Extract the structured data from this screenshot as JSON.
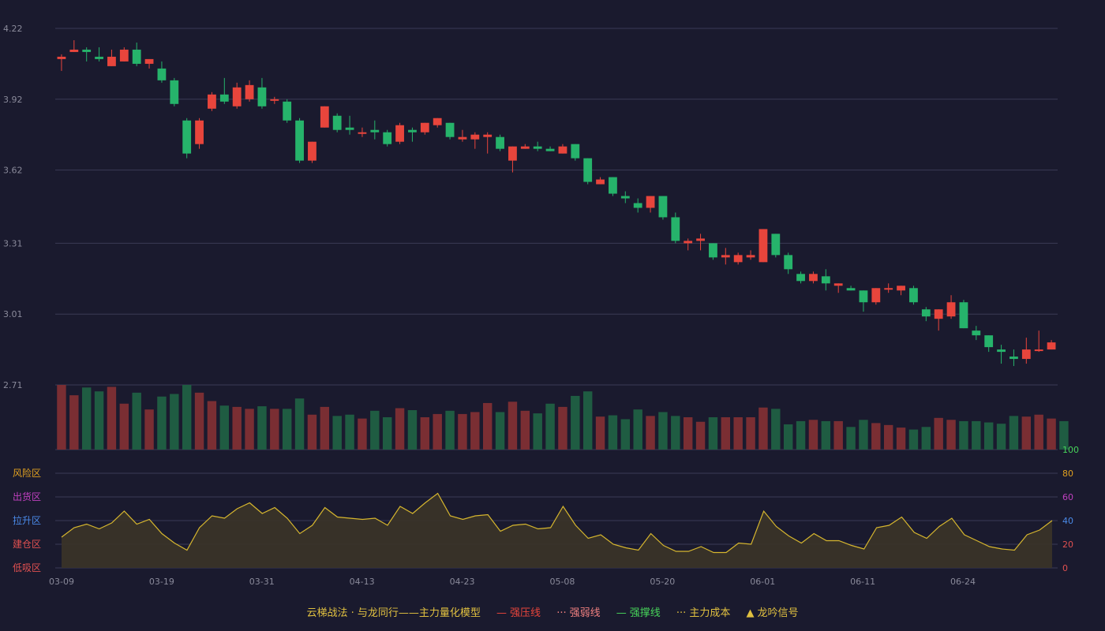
{
  "colors": {
    "background": "#1a1a2e",
    "up": "#e8453c",
    "down": "#26b36b",
    "vol_up": "#7a2e33",
    "vol_down": "#1f5c42",
    "grid": "#3a3a55",
    "axis_text": "#8a8a9a",
    "cost_line": "#d6b62e",
    "cost_fill": "#3b3428"
  },
  "chart_data": [
    {
      "type": "candlestick",
      "price_ticks": [
        "4.22",
        "3.92",
        "3.62",
        "3.31",
        "3.01",
        "2.71"
      ],
      "ylim": [
        2.71,
        4.22
      ],
      "grid": true,
      "candles": [
        [
          4.09,
          4.1,
          4.04,
          4.11
        ],
        [
          4.12,
          4.13,
          4.12,
          4.17
        ],
        [
          4.13,
          4.12,
          4.08,
          4.14
        ],
        [
          4.1,
          4.09,
          4.08,
          4.14
        ],
        [
          4.06,
          4.1,
          4.06,
          4.13
        ],
        [
          4.08,
          4.13,
          4.08,
          4.14
        ],
        [
          4.13,
          4.07,
          4.06,
          4.16
        ],
        [
          4.07,
          4.09,
          4.05,
          4.09
        ],
        [
          4.05,
          4.0,
          3.99,
          4.08
        ],
        [
          4.0,
          3.9,
          3.89,
          4.01
        ],
        [
          3.83,
          3.69,
          3.67,
          3.84
        ],
        [
          3.73,
          3.83,
          3.71,
          3.84
        ],
        [
          3.88,
          3.94,
          3.87,
          3.95
        ],
        [
          3.94,
          3.91,
          3.9,
          4.01
        ],
        [
          3.89,
          3.97,
          3.88,
          3.99
        ],
        [
          3.92,
          3.98,
          3.91,
          4.0
        ],
        [
          3.97,
          3.89,
          3.88,
          4.01
        ],
        [
          3.92,
          3.92,
          3.9,
          3.93
        ],
        [
          3.91,
          3.83,
          3.82,
          3.92
        ],
        [
          3.83,
          3.66,
          3.65,
          3.84
        ],
        [
          3.66,
          3.74,
          3.65,
          3.74
        ],
        [
          3.8,
          3.89,
          3.8,
          3.89
        ],
        [
          3.85,
          3.79,
          3.78,
          3.86
        ],
        [
          3.8,
          3.79,
          3.77,
          3.85
        ],
        [
          3.78,
          3.78,
          3.76,
          3.8
        ],
        [
          3.79,
          3.78,
          3.75,
          3.83
        ],
        [
          3.78,
          3.73,
          3.72,
          3.79
        ],
        [
          3.74,
          3.81,
          3.73,
          3.82
        ],
        [
          3.79,
          3.78,
          3.74,
          3.8
        ],
        [
          3.78,
          3.82,
          3.77,
          3.82
        ],
        [
          3.81,
          3.84,
          3.8,
          3.84
        ],
        [
          3.82,
          3.76,
          3.75,
          3.82
        ],
        [
          3.75,
          3.76,
          3.74,
          3.79
        ],
        [
          3.75,
          3.77,
          3.71,
          3.78
        ],
        [
          3.76,
          3.77,
          3.69,
          3.78
        ],
        [
          3.76,
          3.71,
          3.7,
          3.77
        ],
        [
          3.66,
          3.72,
          3.61,
          3.72
        ],
        [
          3.71,
          3.72,
          3.71,
          3.73
        ],
        [
          3.72,
          3.71,
          3.7,
          3.74
        ],
        [
          3.71,
          3.7,
          3.7,
          3.72
        ],
        [
          3.69,
          3.72,
          3.69,
          3.73
        ],
        [
          3.73,
          3.67,
          3.66,
          3.73
        ],
        [
          3.67,
          3.57,
          3.56,
          3.67
        ],
        [
          3.56,
          3.58,
          3.56,
          3.59
        ],
        [
          3.59,
          3.52,
          3.51,
          3.59
        ],
        [
          3.51,
          3.5,
          3.48,
          3.53
        ],
        [
          3.48,
          3.46,
          3.44,
          3.5
        ],
        [
          3.46,
          3.51,
          3.44,
          3.51
        ],
        [
          3.51,
          3.42,
          3.41,
          3.51
        ],
        [
          3.42,
          3.32,
          3.31,
          3.44
        ],
        [
          3.31,
          3.32,
          3.28,
          3.33
        ],
        [
          3.32,
          3.33,
          3.28,
          3.35
        ],
        [
          3.31,
          3.25,
          3.24,
          3.31
        ],
        [
          3.25,
          3.26,
          3.22,
          3.29
        ],
        [
          3.23,
          3.26,
          3.22,
          3.27
        ],
        [
          3.25,
          3.26,
          3.24,
          3.28
        ],
        [
          3.23,
          3.37,
          3.23,
          3.37
        ],
        [
          3.35,
          3.26,
          3.25,
          3.35
        ],
        [
          3.26,
          3.2,
          3.18,
          3.27
        ],
        [
          3.18,
          3.15,
          3.14,
          3.19
        ],
        [
          3.15,
          3.18,
          3.14,
          3.19
        ],
        [
          3.17,
          3.14,
          3.11,
          3.2
        ],
        [
          3.13,
          3.14,
          3.1,
          3.14
        ],
        [
          3.12,
          3.11,
          3.11,
          3.13
        ],
        [
          3.11,
          3.06,
          3.02,
          3.11
        ],
        [
          3.06,
          3.12,
          3.05,
          3.12
        ],
        [
          3.12,
          3.12,
          3.1,
          3.14
        ],
        [
          3.11,
          3.13,
          3.09,
          3.13
        ],
        [
          3.12,
          3.06,
          3.05,
          3.13
        ],
        [
          3.03,
          3.0,
          2.98,
          3.04
        ],
        [
          2.99,
          3.03,
          2.94,
          3.03
        ],
        [
          3.0,
          3.06,
          2.99,
          3.09
        ],
        [
          3.06,
          2.95,
          2.95,
          3.07
        ],
        [
          2.94,
          2.92,
          2.9,
          2.96
        ],
        [
          2.92,
          2.87,
          2.85,
          2.92
        ],
        [
          2.86,
          2.85,
          2.8,
          2.88
        ],
        [
          2.83,
          2.82,
          2.79,
          2.86
        ],
        [
          2.82,
          2.86,
          2.8,
          2.91
        ],
        [
          2.86,
          2.86,
          2.85,
          2.94
        ],
        [
          2.86,
          2.89,
          2.86,
          2.9
        ]
      ]
    },
    {
      "type": "bar",
      "name": "volume",
      "values": [
        100,
        84,
        96,
        90,
        97,
        71,
        88,
        62,
        82,
        86,
        100,
        88,
        75,
        68,
        66,
        63,
        67,
        63,
        63,
        79,
        54,
        66,
        52,
        54,
        48,
        60,
        50,
        64,
        61,
        50,
        55,
        60,
        55,
        58,
        72,
        58,
        74,
        60,
        56,
        71,
        66,
        83,
        90,
        51,
        53,
        47,
        62,
        52,
        58,
        52,
        50,
        43,
        50,
        50,
        50,
        50,
        65,
        63,
        39,
        44,
        46,
        44,
        44,
        35,
        46,
        41,
        38,
        34,
        31,
        35,
        49,
        46,
        44,
        44,
        42,
        40,
        52,
        51,
        54,
        48,
        44
      ]
    },
    {
      "type": "area",
      "name": "主力成本",
      "ylim": [
        0,
        100
      ],
      "y_ticks": [
        "100",
        "80",
        "60",
        "40",
        "20",
        "0"
      ],
      "zone_labels": [
        "风险区",
        "出货区",
        "拉升区",
        "建仓区",
        "低吸区"
      ],
      "x_ticks": [
        "03-09",
        "03-19",
        "03-31",
        "04-13",
        "04-23",
        "05-08",
        "05-20",
        "06-01",
        "06-11",
        "06-24"
      ],
      "values": [
        26,
        34,
        37,
        33,
        38,
        48,
        37,
        41,
        29,
        21,
        15,
        34,
        44,
        42,
        50,
        55,
        46,
        51,
        42,
        29,
        36,
        51,
        43,
        42,
        41,
        42,
        36,
        52,
        46,
        55,
        63,
        44,
        41,
        44,
        45,
        31,
        36,
        37,
        33,
        34,
        52,
        36,
        25,
        28,
        20,
        17,
        15,
        29,
        19,
        14,
        14,
        18,
        13,
        13,
        21,
        20,
        48,
        35,
        27,
        21,
        29,
        23,
        23,
        19,
        16,
        34,
        36,
        43,
        30,
        25,
        35,
        42,
        28,
        23,
        18,
        16,
        15,
        28,
        32,
        40
      ]
    }
  ],
  "legend": {
    "title": "云梯战法 · 与龙同行——主力量化模型",
    "items": [
      {
        "label": "强压线",
        "color": "#e8453c",
        "symbol": "—"
      },
      {
        "label": "强弱线",
        "color": "#f08080",
        "symbol": "···"
      },
      {
        "label": "强撑线",
        "color": "#47d45a",
        "symbol": "—"
      },
      {
        "label": "主力成本",
        "color": "#e0c040",
        "symbol": "···"
      },
      {
        "label": "龙吟信号",
        "color": "#e0c040",
        "symbol": "▲"
      }
    ]
  }
}
